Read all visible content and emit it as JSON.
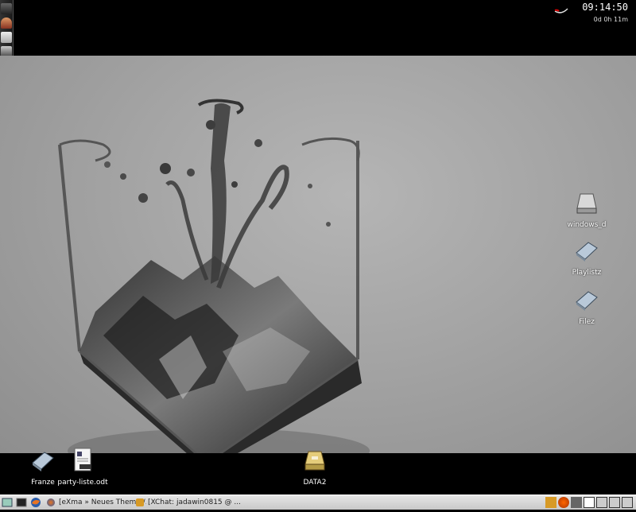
{
  "clock": {
    "time": "09:14:50",
    "uptime": "0d 0h 11m"
  },
  "desktop_icons": {
    "windows_d": "windows_d",
    "playlistz": "Playlistz",
    "filez": "Filez",
    "franze": "Franze",
    "party_liste": "party-liste.odt",
    "data2": "DATA2"
  },
  "taskbar": {
    "tasks": [
      {
        "label": "[eXma » Neues Thema /..."
      },
      {
        "label": "[XChat: jadawin0815 @ ..."
      }
    ]
  },
  "colors": {
    "wallpaper": "#a4a4a4",
    "taskbar": "#d6d6d6",
    "bar": "#000000"
  },
  "icons": [
    "terminal-icon",
    "firefox-icon",
    "xchat-icon",
    "drive-icon",
    "folder-icon",
    "document-icon"
  ]
}
